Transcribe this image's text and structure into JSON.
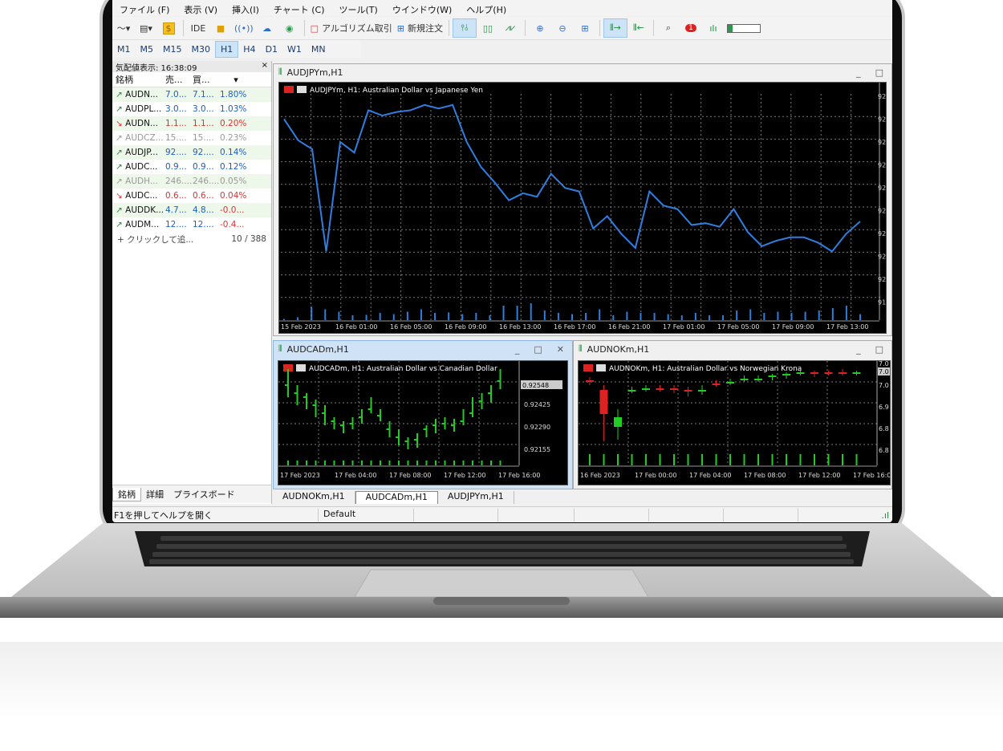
{
  "menu": [
    "ファイル (F)",
    "表示 (V)",
    "挿入(I)",
    "チャート (C)",
    "ツール(T)",
    "ウインドウ(W)",
    "ヘルプ(H)"
  ],
  "toolbar": {
    "ide": "IDE",
    "algo": "アルゴリズム取引",
    "new_order": "新規注文",
    "notif_count": "1"
  },
  "timeframes": [
    "M1",
    "M5",
    "M15",
    "M30",
    "H1",
    "H4",
    "D1",
    "W1",
    "MN"
  ],
  "selected_timeframe": "H1",
  "market_watch": {
    "title": "気配値表示: 16:38:09",
    "close": "×",
    "columns": [
      "銘柄",
      "売...",
      "買...",
      ""
    ],
    "rows": [
      {
        "sym": "AUDN...",
        "bid": "7.0...",
        "ask": "7.1...",
        "chg": "1.80%",
        "dir": "up"
      },
      {
        "sym": "AUDPL...",
        "bid": "3.0...",
        "ask": "3.0...",
        "chg": "1.03%",
        "dir": "up"
      },
      {
        "sym": "AUDN...",
        "bid": "1.1...",
        "ask": "1.1...",
        "chg": "0.20%",
        "dir": "down"
      },
      {
        "sym": "AUDCZ...",
        "bid": "15....",
        "ask": "15....",
        "chg": "0.23%",
        "dir": "gray"
      },
      {
        "sym": "AUDJP...",
        "bid": "92....",
        "ask": "92....",
        "chg": "0.14%",
        "dir": "up"
      },
      {
        "sym": "AUDC...",
        "bid": "0.9...",
        "ask": "0.9...",
        "chg": "0.12%",
        "dir": "up"
      },
      {
        "sym": "AUDH...",
        "bid": "246....",
        "ask": "246....",
        "chg": "0.05%",
        "dir": "gray"
      },
      {
        "sym": "AUDC...",
        "bid": "0.6...",
        "ask": "0.6...",
        "chg": "0.04%",
        "dir": "down"
      },
      {
        "sym": "AUDDK...",
        "bid": "4.7...",
        "ask": "4.8...",
        "chg": "-0.0...",
        "dir": "up"
      },
      {
        "sym": "AUDM...",
        "bid": "12....",
        "ask": "12....",
        "chg": "-0.4...",
        "dir": "up"
      }
    ],
    "add_label": "+ クリックして追...",
    "count": "10 / 388",
    "tabs": [
      "銘柄",
      "詳細",
      "プライスボード"
    ]
  },
  "charts": {
    "audjpy": {
      "window_title": "AUDJPYm,H1",
      "header": "AUDJPYm, H1:  Australian Dollar vs Japanese Yen",
      "yticks": [
        "92",
        "92",
        "92",
        "92",
        "92",
        "92",
        "92",
        "92",
        "92",
        "91"
      ],
      "xticks": [
        "15 Feb 2023",
        "16 Feb 01:00",
        "16 Feb 05:00",
        "16 Feb 09:00",
        "16 Feb 13:00",
        "16 Feb 17:00",
        "16 Feb 21:00",
        "17 Feb 01:00",
        "17 Feb 05:00",
        "17 Feb 09:00",
        "17 Feb 13:00"
      ],
      "line": [
        0.93,
        0.81,
        0.76,
        0.18,
        0.8,
        0.74,
        0.98,
        0.95,
        0.97,
        0.98,
        1.01,
        0.99,
        1.01,
        0.8,
        0.66,
        0.57,
        0.47,
        0.51,
        0.49,
        0.62,
        0.54,
        0.52,
        0.31,
        0.38,
        0.28,
        0.2,
        0.52,
        0.44,
        0.42,
        0.33,
        0.34,
        0.32,
        0.42,
        0.29,
        0.21,
        0.24,
        0.26,
        0.26,
        0.23,
        0.18,
        0.28,
        0.35
      ],
      "volume": [
        0.05,
        0.12,
        0.55,
        0.45,
        0.35,
        0.2,
        0.22,
        0.3,
        0.25,
        0.35,
        0.45,
        0.3,
        0.32,
        0.25,
        0.3,
        0.2,
        0.6,
        0.6,
        0.7,
        0.4,
        0.3,
        0.25,
        0.3,
        0.45,
        0.2,
        0.35,
        0.3,
        0.3,
        0.25,
        0.2,
        0.3,
        0.2,
        0.2,
        0.4,
        0.45,
        0.3,
        0.35,
        0.3,
        0.35,
        0.4,
        0.5,
        0.6,
        0.25
      ]
    },
    "audcad": {
      "window_title": "AUDCADm,H1",
      "header": "AUDCADm, H1:  Australian Dollar vs Canadian Dollar",
      "price_tag": "0.92548",
      "yticks": [
        "0.92425",
        "0.92290",
        "0.92155"
      ],
      "xticks": [
        "17 Feb 2023",
        "17 Feb 04:00",
        "17 Feb 08:00",
        "17 Feb 12:00",
        "17 Feb 16:00"
      ]
    },
    "audnok": {
      "window_title": "AUDNOKm,H1",
      "header": "AUDNOKm, H1:  Australian Dollar vs Norwegian Krona",
      "price_tag": "7.0",
      "yticks": [
        "7.0",
        "7.0",
        "6.9",
        "6.8",
        "6.8"
      ],
      "xticks": [
        "16 Feb 2023",
        "17 Feb 00:00",
        "17 Feb 04:00",
        "17 Feb 08:00",
        "17 Feb 12:00",
        "17 Feb 16:0"
      ]
    }
  },
  "chart_tabs": [
    "AUDNOKm,H1",
    "AUDCADm,H1",
    "AUDJPYm,H1"
  ],
  "active_chart_tab": "AUDCADm,H1",
  "status": {
    "help": "F1を押してヘルプを開く",
    "profile": "Default"
  },
  "colors": {
    "line": "#2f7fe0",
    "bull": "#22cc22",
    "bear": "#dd2222",
    "grid": "#888888"
  }
}
